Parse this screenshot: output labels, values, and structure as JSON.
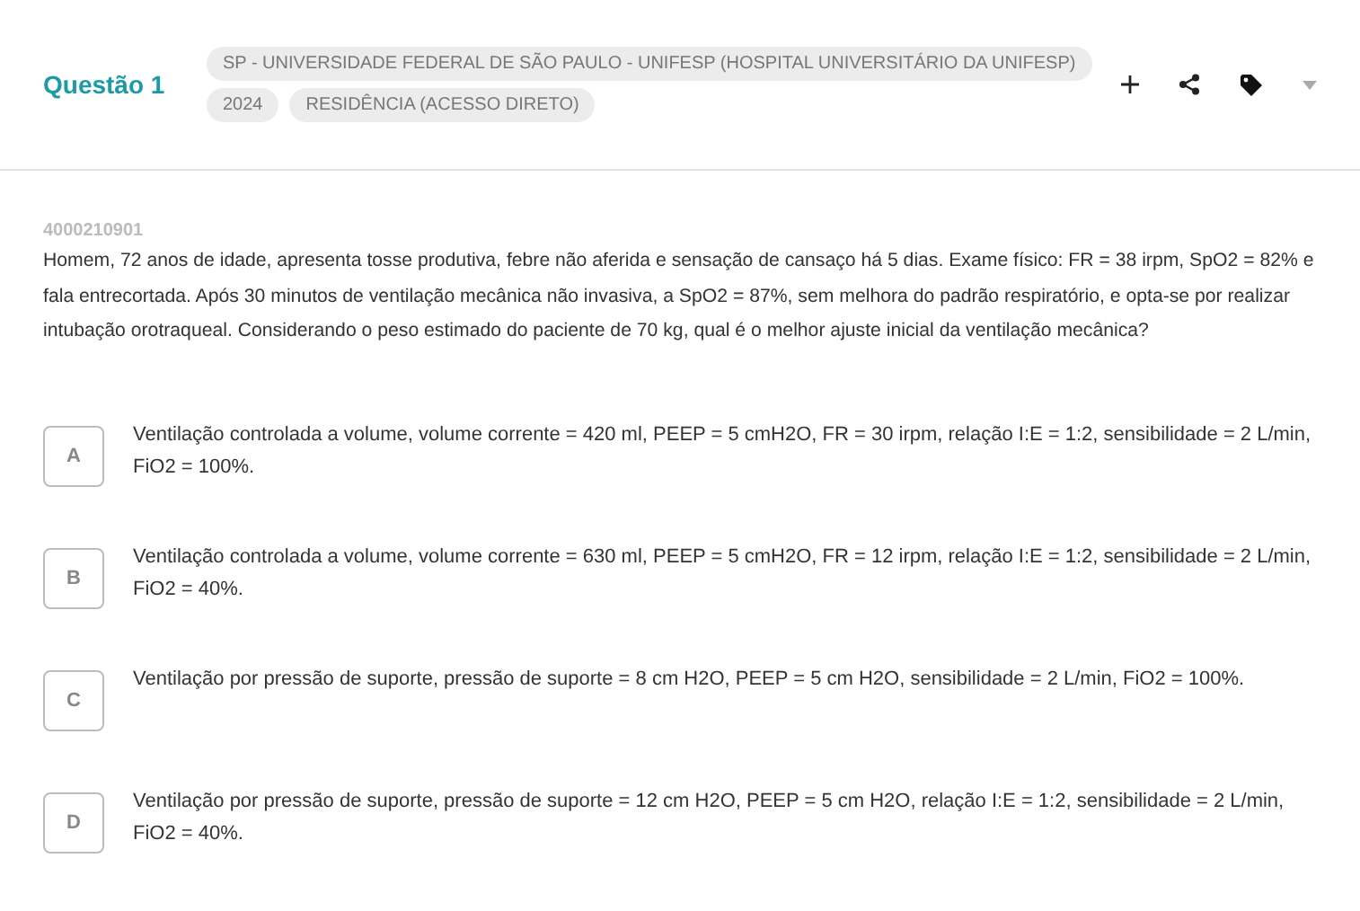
{
  "header": {
    "title": "Questão 1",
    "tags": [
      [
        "SP - UNIVERSIDADE FEDERAL DE SÃO PAULO - UNIFESP (HOSPITAL UNIVERSITÁRIO DA UNIFESP)"
      ],
      [
        "2024",
        "RESIDÊNCIA (ACESSO DIRETO)"
      ]
    ]
  },
  "question": {
    "id": "4000210901",
    "text": "Homem, 72 anos de idade, apresenta tosse produtiva, febre não aferida e sensação de cansaço há 5 dias. Exame físico: FR = 38 irpm, SpO2 = 82% e fala entrecortada. Após 30 minutos de ventilação mecânica não invasiva, a SpO2 = 87%, sem melhora do padrão respiratório, e opta-se por realizar intubação orotraqueal. Considerando o peso estimado do paciente de 70 kg, qual é o melhor ajuste inicial da ventilação mecânica?"
  },
  "options": [
    {
      "letter": "A",
      "text": "Ventilação controlada a volume, volume corrente = 420 ml, PEEP = 5 cmH2O, FR = 30 irpm, relação I:E = 1:2, sensibilidade = 2 L/min, FiO2 = 100%."
    },
    {
      "letter": "B",
      "text": "Ventilação controlada a volume, volume corrente = 630 ml, PEEP = 5 cmH2O, FR = 12 irpm, relação I:E = 1:2, sensibilidade = 2 L/min, FiO2 = 40%."
    },
    {
      "letter": "C",
      "text": "Ventilação por pressão de suporte, pressão de suporte = 8 cm H2O, PEEP = 5 cm H2O, sensibilidade = 2 L/min, FiO2 = 100%."
    },
    {
      "letter": "D",
      "text": "Ventilação por pressão de suporte, pressão de suporte = 12 cm H2O, PEEP = 5 cm H2O, relação I:E = 1:2, sensibilidade = 2 L/min, FiO2 = 40%."
    }
  ]
}
